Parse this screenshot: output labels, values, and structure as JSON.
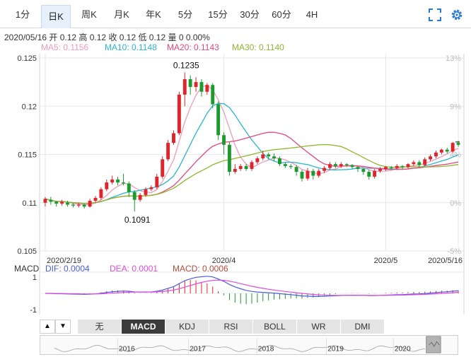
{
  "tabs": [
    "1分",
    "日K",
    "周K",
    "月K",
    "年K",
    "5分",
    "15分",
    "30分",
    "60分",
    "4H"
  ],
  "active_tab": 1,
  "toolbar": {
    "fullscreen_icon": "fullscreen-icon",
    "settings_icon": "gear-icon"
  },
  "info_line": "2020/05/16 开 0.12 高 0.12 收 0.12 低 0.12 量 0 0.00%",
  "ma_legend": [
    {
      "label": "MA5: 0.1156",
      "color": "#f29bb8"
    },
    {
      "label": "MA10: 0.1148",
      "color": "#29b6d0"
    },
    {
      "label": "MA20: 0.1143",
      "color": "#e8467c"
    },
    {
      "label": "MA30: 0.1140",
      "color": "#8db82c"
    }
  ],
  "colors": {
    "up": "#e0242b",
    "down": "#1b9b2e",
    "grid": "#e7e7e7",
    "dif": "#4a5ce0",
    "dea": "#e04be0",
    "macd_label": "#b54b3c"
  },
  "chart_data": {
    "type": "candlestick",
    "y_ticks_left": [
      "0.125",
      "0.12",
      "0.115",
      "0.11",
      "0.105"
    ],
    "y_ticks_right": [
      "13%",
      "9%",
      "4%",
      "0%",
      "-5%"
    ],
    "ylim": [
      0.105,
      0.125
    ],
    "x_labels": [
      "2020/2/19",
      "2020/4",
      "2020/5",
      "2020/5/16"
    ],
    "annotations": [
      {
        "text": "0.1235",
        "index": 25
      },
      {
        "text": "0.1091",
        "index": 16
      }
    ],
    "candles": [
      [
        0.11,
        0.1104,
        0.1096,
        0.1106
      ],
      [
        0.1103,
        0.1101,
        0.1098,
        0.1106
      ],
      [
        0.1101,
        0.1099,
        0.1096,
        0.1102
      ],
      [
        0.1099,
        0.1101,
        0.1097,
        0.1103
      ],
      [
        0.11,
        0.1098,
        0.1096,
        0.1102
      ],
      [
        0.1098,
        0.1097,
        0.1095,
        0.11
      ],
      [
        0.1097,
        0.1098,
        0.1095,
        0.11
      ],
      [
        0.1098,
        0.1096,
        0.1094,
        0.1099
      ],
      [
        0.1096,
        0.1102,
        0.1095,
        0.1104
      ],
      [
        0.1102,
        0.1105,
        0.11,
        0.1107
      ],
      [
        0.1105,
        0.1114,
        0.1103,
        0.1116
      ],
      [
        0.1114,
        0.1121,
        0.1112,
        0.1124
      ],
      [
        0.1121,
        0.1124,
        0.1119,
        0.1128
      ],
      [
        0.1124,
        0.1121,
        0.1118,
        0.1127
      ],
      [
        0.1121,
        0.112,
        0.1118,
        0.113
      ],
      [
        0.112,
        0.1111,
        0.1106,
        0.1122
      ],
      [
        0.1111,
        0.1103,
        0.1091,
        0.1113
      ],
      [
        0.1103,
        0.1108,
        0.1101,
        0.111
      ],
      [
        0.1108,
        0.1114,
        0.1106,
        0.1116
      ],
      [
        0.1114,
        0.1116,
        0.1112,
        0.1118
      ],
      [
        0.1116,
        0.1127,
        0.1114,
        0.113
      ],
      [
        0.1127,
        0.1145,
        0.1125,
        0.1148
      ],
      [
        0.1145,
        0.1162,
        0.1143,
        0.1165
      ],
      [
        0.1162,
        0.1172,
        0.116,
        0.1175
      ],
      [
        0.1172,
        0.1212,
        0.117,
        0.1215
      ],
      [
        0.1212,
        0.1228,
        0.12,
        0.1235
      ],
      [
        0.1228,
        0.122,
        0.1212,
        0.1232
      ],
      [
        0.122,
        0.1225,
        0.1215,
        0.123
      ],
      [
        0.1225,
        0.1215,
        0.121,
        0.1228
      ],
      [
        0.1215,
        0.1222,
        0.1212,
        0.1224
      ],
      [
        0.1222,
        0.1202,
        0.1198,
        0.1224
      ],
      [
        0.1202,
        0.117,
        0.1165,
        0.1205
      ],
      [
        0.117,
        0.116,
        0.115,
        0.1173
      ],
      [
        0.116,
        0.1132,
        0.1128,
        0.1163
      ],
      [
        0.1132,
        0.1135,
        0.113,
        0.114
      ],
      [
        0.1135,
        0.1138,
        0.1133,
        0.114
      ],
      [
        0.1138,
        0.1135,
        0.1133,
        0.114
      ],
      [
        0.1135,
        0.1142,
        0.1133,
        0.1144
      ],
      [
        0.1142,
        0.1146,
        0.114,
        0.1148
      ],
      [
        0.1146,
        0.115,
        0.1144,
        0.1154
      ],
      [
        0.115,
        0.1148,
        0.1145,
        0.1152
      ],
      [
        0.1148,
        0.1146,
        0.1143,
        0.1151
      ],
      [
        0.1146,
        0.114,
        0.1138,
        0.1148
      ],
      [
        0.114,
        0.1138,
        0.1136,
        0.1142
      ],
      [
        0.1138,
        0.1137,
        0.1135,
        0.114
      ],
      [
        0.1137,
        0.1132,
        0.1128,
        0.1139
      ],
      [
        0.1132,
        0.1125,
        0.1122,
        0.1134
      ],
      [
        0.1125,
        0.1133,
        0.1123,
        0.1136
      ],
      [
        0.1133,
        0.1128,
        0.1124,
        0.1135
      ],
      [
        0.1128,
        0.1133,
        0.1126,
        0.1135
      ],
      [
        0.1133,
        0.1136,
        0.1131,
        0.1138
      ],
      [
        0.1136,
        0.114,
        0.1134,
        0.1142
      ],
      [
        0.114,
        0.1138,
        0.1136,
        0.1142
      ],
      [
        0.1138,
        0.114,
        0.1136,
        0.1142
      ],
      [
        0.114,
        0.1139,
        0.1137,
        0.1141
      ],
      [
        0.1139,
        0.1137,
        0.1135,
        0.114
      ],
      [
        0.1137,
        0.1135,
        0.1132,
        0.1138
      ],
      [
        0.1135,
        0.1132,
        0.1129,
        0.1136
      ],
      [
        0.1132,
        0.1127,
        0.1124,
        0.1134
      ],
      [
        0.1127,
        0.1133,
        0.1125,
        0.1135
      ],
      [
        0.1133,
        0.1135,
        0.1131,
        0.1137
      ],
      [
        0.1135,
        0.1137,
        0.1133,
        0.1138
      ],
      [
        0.1137,
        0.1136,
        0.1134,
        0.1138
      ],
      [
        0.1136,
        0.1138,
        0.1134,
        0.114
      ],
      [
        0.1138,
        0.1137,
        0.1135,
        0.1139
      ],
      [
        0.1137,
        0.114,
        0.1135,
        0.1141
      ],
      [
        0.114,
        0.1142,
        0.1138,
        0.1144
      ],
      [
        0.1142,
        0.1139,
        0.1137,
        0.1144
      ],
      [
        0.1139,
        0.1145,
        0.1138,
        0.1147
      ],
      [
        0.1145,
        0.1148,
        0.1143,
        0.115
      ],
      [
        0.1148,
        0.1152,
        0.1146,
        0.1154
      ],
      [
        0.1152,
        0.1155,
        0.115,
        0.1156
      ],
      [
        0.1155,
        0.1153,
        0.1151,
        0.1157
      ],
      [
        0.1153,
        0.1162,
        0.1152,
        0.1163
      ],
      [
        0.1162,
        0.116,
        0.1158,
        0.1164
      ]
    ],
    "macd": {
      "label": "MACD",
      "dif_label": "DIF: 0.0004",
      "dea_label": "DEA: 0.0001",
      "macd_label": "MACD: 0.0006",
      "y_ticks": [
        "1",
        "-1"
      ],
      "ylim": [
        -1.3,
        1.3
      ]
    }
  },
  "indicator_tabs": [
    "无",
    "MACD",
    "KDJ",
    "RSI",
    "BOLL",
    "WR",
    "DMI"
  ],
  "active_indicator": 1,
  "navigator": {
    "years": [
      "2016",
      "2017",
      "2018",
      "2019",
      "2020"
    ]
  }
}
